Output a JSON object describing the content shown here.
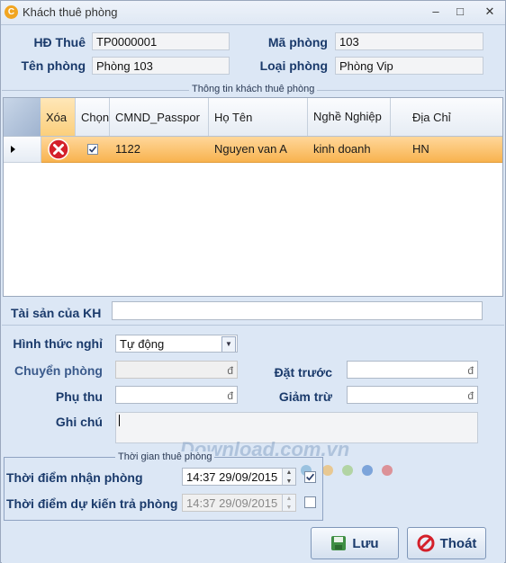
{
  "window": {
    "title": "Khách thuê phòng",
    "minimize": "–",
    "maximize": "□",
    "close": "✕",
    "app_icon": "C"
  },
  "header": {
    "contract_label": "HĐ Thuê",
    "contract_value": "TP0000001",
    "room_code_label": "Mã phòng",
    "room_code_value": "103",
    "room_name_label": "Tên phòng",
    "room_name_value": "Phòng 103",
    "room_type_label": "Loại phòng",
    "room_type_value": "Phòng Vip"
  },
  "guests": {
    "legend": "Thông tin khách thuê phòng",
    "columns": [
      "Xóa",
      "Chọn",
      "CMND_Passpor",
      "Họ Tên",
      "Nghề Nghiệp",
      "Địa Chỉ"
    ],
    "rows": [
      {
        "cmnd": "1122",
        "name": "Nguyen van A",
        "job": "kinh doanh",
        "address": "HN",
        "selected": true
      }
    ]
  },
  "assets": {
    "label": "Tài sản của KH",
    "value": ""
  },
  "form": {
    "stay_type_label": "Hình thức nghỉ",
    "stay_type_value": "Tự động",
    "transfer_label": "Chuyển phòng",
    "transfer_suffix": "đ",
    "deposit_label": "Đặt trước",
    "deposit_suffix": "đ",
    "surcharge_label": "Phụ thu",
    "surcharge_suffix": "đ",
    "discount_label": "Giảm trừ",
    "discount_suffix": "đ",
    "note_label": "Ghi chú",
    "note_value": ""
  },
  "time": {
    "legend": "Thời gian thuê phòng",
    "checkin_label": "Thời điểm nhận phòng",
    "checkin_value": "14:37 29/09/2015",
    "checkin_checked": true,
    "checkout_label": "Thời điểm dự kiến trả phòng",
    "checkout_value": "14:37 29/09/2015",
    "checkout_checked": false
  },
  "watermark": "Download.com.vn",
  "buttons": {
    "save": "Lưu",
    "exit": "Thoát"
  },
  "colors": {
    "selected_row": "#f8b34f",
    "delete_icon": "#d4202a",
    "accent_text": "#1a3a6b"
  }
}
